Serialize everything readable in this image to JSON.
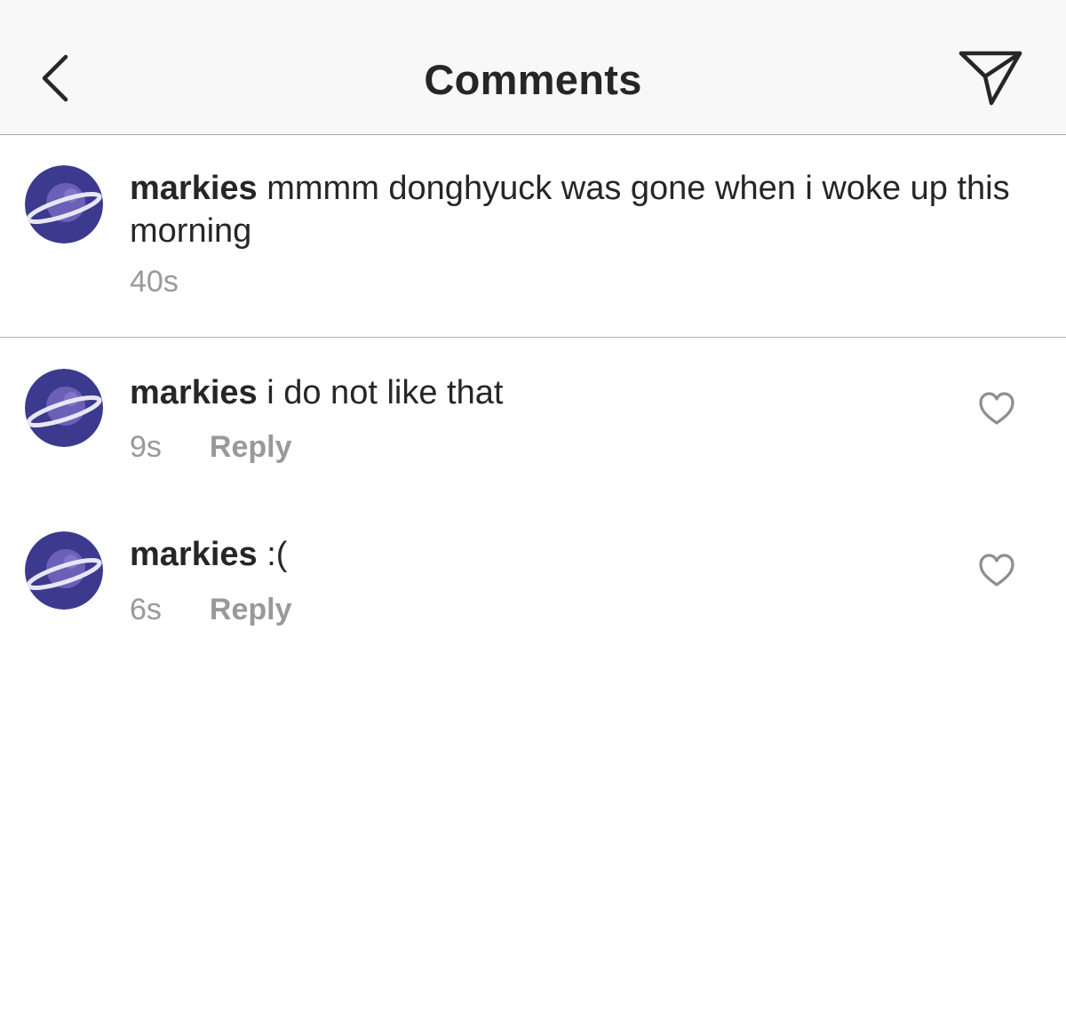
{
  "header": {
    "title": "Comments",
    "back_icon": "chevron-left-icon",
    "send_icon": "paper-plane-icon"
  },
  "caption": {
    "username": "markies",
    "text": "mmmm donghyuck was gone when i woke up this morning",
    "time": "40s"
  },
  "comments": [
    {
      "username": "markies",
      "text": "i do not like that",
      "time": "9s",
      "reply_label": "Reply",
      "like_icon": "heart-outline-icon"
    },
    {
      "username": "markies",
      "text": ":(",
      "time": "6s",
      "reply_label": "Reply",
      "like_icon": "heart-outline-icon"
    }
  ],
  "colors": {
    "header_bg": "#f8f8f8",
    "text": "#262626",
    "secondary_text": "#999999",
    "avatar_bg": "#3b3a8e"
  }
}
